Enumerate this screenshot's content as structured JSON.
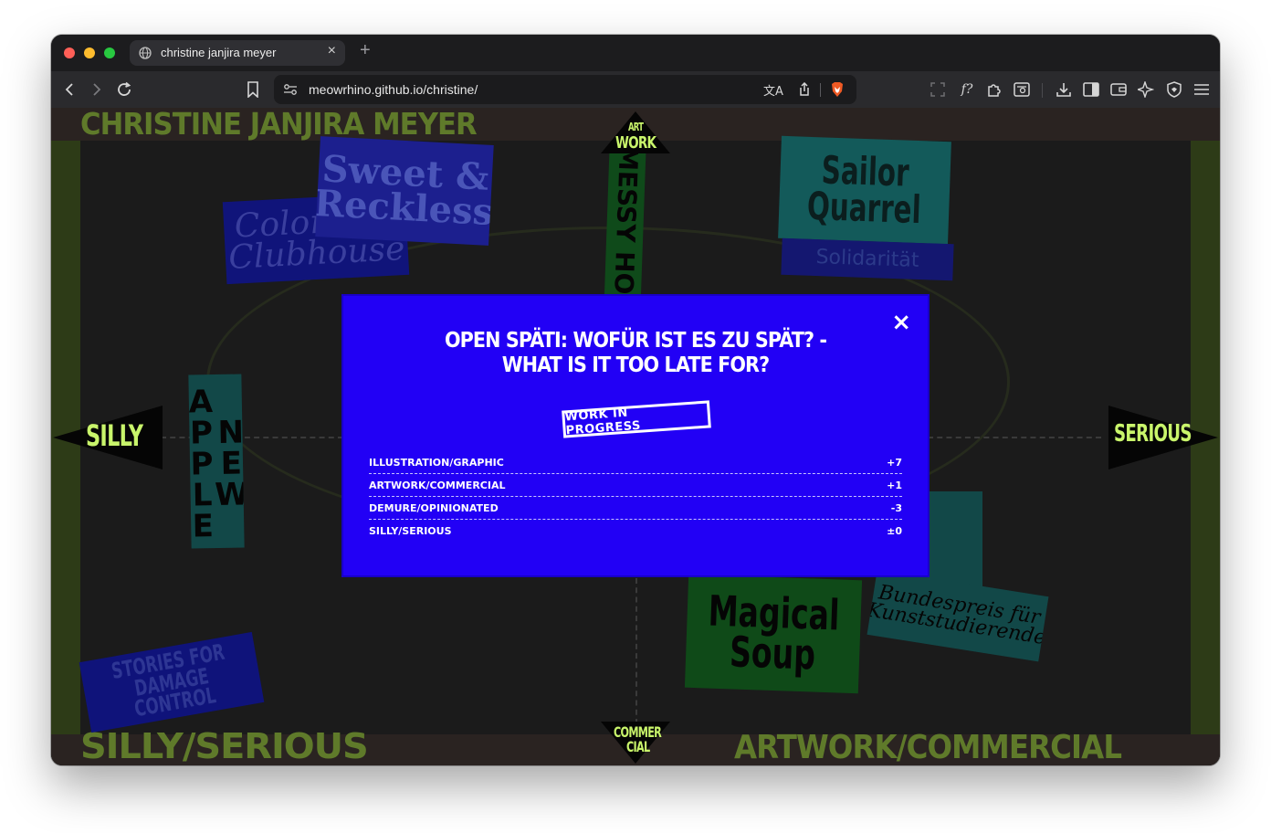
{
  "browser": {
    "tab_title": "christine janjira meyer",
    "new_tab": "+",
    "tab_close": "×",
    "url": "meowrhino.github.io/christine/"
  },
  "page": {
    "header_top": "CHRISTINE JANJIRA MEYER",
    "footer_left": "SILLY/SERIOUS",
    "footer_right": "ARTWORK/COMMERCIAL",
    "pennants": {
      "top": [
        "ART",
        "WORK"
      ],
      "bottom": [
        "COMMER",
        "CIAL"
      ],
      "left": "SILLY",
      "right": "SERIOUS"
    },
    "cards": {
      "colorama": "Colorama Clubhouse",
      "sweet": "Sweet & Reckless",
      "messy": "MESSY HOOD",
      "sailor": "Sailor Quarrel",
      "solidarity": "Solidarität",
      "new_apple": "NEW APPLE",
      "stories": "STORIES FOR DAMAGE CONTROL",
      "magical": "Magical Soup",
      "bundes": "Bundespreis für Kunststudierende"
    }
  },
  "modal": {
    "close_label": "×",
    "title": "OPEN SPÄTI: WOFÜR IST ES ZU SPÄT? - WHAT IS IT TOO LATE FOR?",
    "badge": "WORK IN PROGRESS",
    "stats": [
      {
        "label": "ILLUSTRATION/GRAPHIC",
        "value": "+7"
      },
      {
        "label": "ARTWORK/COMMERCIAL",
        "value": "+1"
      },
      {
        "label": "DEMURE/OPINIONATED",
        "value": "-3"
      },
      {
        "label": "SILLY/SERIOUS",
        "value": "±0"
      }
    ]
  },
  "colors": {
    "modal_bg": "#2200f5",
    "accent_green": "#c9f56b",
    "band_green": "#2d3b17",
    "title_green": "#5f7a2a"
  }
}
